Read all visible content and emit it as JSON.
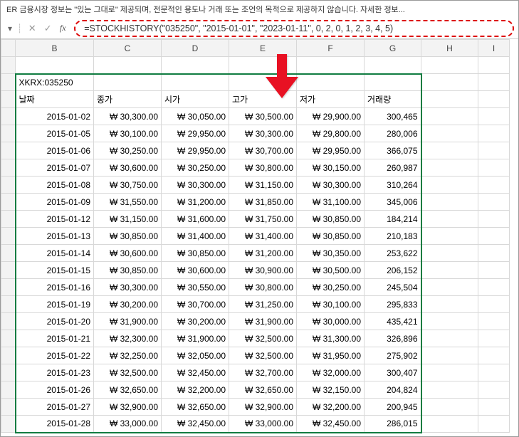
{
  "disclaimer": "ER   금융시장 정보는 \"있는 그대로\" 제공되며, 전문적인 용도나 거래 또는 조언의 목적으로 제공하지 않습니다. 자세한 정보...",
  "namebox_dropdown": "▾",
  "formula": "=STOCKHISTORY(\"035250\", \"2015-01-01\", \"2023-01-11\", 0, 2, 0, 1, 2, 3, 4, 5)",
  "columns": [
    "B",
    "C",
    "D",
    "E",
    "F",
    "G",
    "H",
    "I"
  ],
  "ticker": "XKRX:035250",
  "headers": {
    "date": "날짜",
    "close": "종가",
    "open": "시가",
    "high": "고가",
    "low": "저가",
    "volume": "거래량"
  },
  "rows": [
    {
      "date": "2015-01-02",
      "close": "₩  30,300.00",
      "open": "₩  30,050.00",
      "high": "₩  30,500.00",
      "low": "₩  29,900.00",
      "volume": "300,465"
    },
    {
      "date": "2015-01-05",
      "close": "₩  30,100.00",
      "open": "₩  29,950.00",
      "high": "₩  30,300.00",
      "low": "₩  29,800.00",
      "volume": "280,006"
    },
    {
      "date": "2015-01-06",
      "close": "₩  30,250.00",
      "open": "₩  29,950.00",
      "high": "₩  30,700.00",
      "low": "₩  29,950.00",
      "volume": "366,075"
    },
    {
      "date": "2015-01-07",
      "close": "₩  30,600.00",
      "open": "₩  30,250.00",
      "high": "₩  30,800.00",
      "low": "₩  30,150.00",
      "volume": "260,987"
    },
    {
      "date": "2015-01-08",
      "close": "₩  30,750.00",
      "open": "₩  30,300.00",
      "high": "₩  31,150.00",
      "low": "₩  30,300.00",
      "volume": "310,264"
    },
    {
      "date": "2015-01-09",
      "close": "₩  31,550.00",
      "open": "₩  31,200.00",
      "high": "₩  31,850.00",
      "low": "₩  31,100.00",
      "volume": "345,006"
    },
    {
      "date": "2015-01-12",
      "close": "₩  31,150.00",
      "open": "₩  31,600.00",
      "high": "₩  31,750.00",
      "low": "₩  30,850.00",
      "volume": "184,214"
    },
    {
      "date": "2015-01-13",
      "close": "₩  30,850.00",
      "open": "₩  31,400.00",
      "high": "₩  31,400.00",
      "low": "₩  30,850.00",
      "volume": "210,183"
    },
    {
      "date": "2015-01-14",
      "close": "₩  30,600.00",
      "open": "₩  30,850.00",
      "high": "₩  31,200.00",
      "low": "₩  30,350.00",
      "volume": "253,622"
    },
    {
      "date": "2015-01-15",
      "close": "₩  30,850.00",
      "open": "₩  30,600.00",
      "high": "₩  30,900.00",
      "low": "₩  30,500.00",
      "volume": "206,152"
    },
    {
      "date": "2015-01-16",
      "close": "₩  30,300.00",
      "open": "₩  30,550.00",
      "high": "₩  30,800.00",
      "low": "₩  30,250.00",
      "volume": "245,504"
    },
    {
      "date": "2015-01-19",
      "close": "₩  30,200.00",
      "open": "₩  30,700.00",
      "high": "₩  31,250.00",
      "low": "₩  30,100.00",
      "volume": "295,833"
    },
    {
      "date": "2015-01-20",
      "close": "₩  31,900.00",
      "open": "₩  30,200.00",
      "high": "₩  31,900.00",
      "low": "₩  30,000.00",
      "volume": "435,421"
    },
    {
      "date": "2015-01-21",
      "close": "₩  32,300.00",
      "open": "₩  31,900.00",
      "high": "₩  32,500.00",
      "low": "₩  31,300.00",
      "volume": "326,896"
    },
    {
      "date": "2015-01-22",
      "close": "₩  32,250.00",
      "open": "₩  32,050.00",
      "high": "₩  32,500.00",
      "low": "₩  31,950.00",
      "volume": "275,902"
    },
    {
      "date": "2015-01-23",
      "close": "₩  32,500.00",
      "open": "₩  32,450.00",
      "high": "₩  32,700.00",
      "low": "₩  32,000.00",
      "volume": "300,407"
    },
    {
      "date": "2015-01-26",
      "close": "₩  32,650.00",
      "open": "₩  32,200.00",
      "high": "₩  32,650.00",
      "low": "₩  32,150.00",
      "volume": "204,824"
    },
    {
      "date": "2015-01-27",
      "close": "₩  32,900.00",
      "open": "₩  32,650.00",
      "high": "₩  32,900.00",
      "low": "₩  32,200.00",
      "volume": "200,945"
    },
    {
      "date": "2015-01-28",
      "close": "₩  33,000.00",
      "open": "₩  32,450.00",
      "high": "₩  33,000.00",
      "low": "₩  32,450.00",
      "volume": "286,015"
    }
  ]
}
